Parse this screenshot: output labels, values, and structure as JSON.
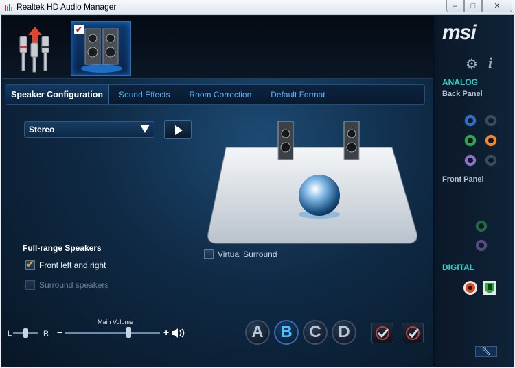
{
  "window": {
    "title": "Realtek HD Audio Manager",
    "controls": {
      "minimize": "–",
      "maximize": "□",
      "close": "✕"
    }
  },
  "tabs": [
    {
      "label": "Speaker Configuration",
      "active": true
    },
    {
      "label": "Sound Effects",
      "active": false
    },
    {
      "label": "Room Correction",
      "active": false
    },
    {
      "label": "Default Format",
      "active": false
    }
  ],
  "speaker_config": {
    "selected": "Stereo",
    "full_range_title": "Full-range Speakers",
    "front_left_right": {
      "label": "Front left and right",
      "checked": true
    },
    "surround_speakers": {
      "label": "Surround speakers",
      "checked": false,
      "disabled": true
    },
    "virtual_surround": {
      "label": "Virtual Surround",
      "checked": false
    }
  },
  "volume": {
    "balance_left": "L",
    "balance_right": "R",
    "balance_level": 0.55,
    "main_label": "Main Volume",
    "main_level": 0.65
  },
  "profiles": [
    {
      "label": "A",
      "active": false
    },
    {
      "label": "B",
      "active": true
    },
    {
      "label": "C",
      "active": false
    },
    {
      "label": "D",
      "active": false
    }
  ],
  "right_panel": {
    "brand": "msi",
    "analog": "ANALOG",
    "back_panel": "Back Panel",
    "front_panel": "Front Panel",
    "digital": "DIGITAL"
  },
  "colors": {
    "accent": "#2ad1c7",
    "tab_text": "#5db4f5",
    "jack_blue": "#2f6fd0",
    "jack_green": "#2ea84a",
    "jack_orange": "#f08a2a",
    "jack_purple": "#8f6fc8",
    "jack_gray": "#5a6e82"
  }
}
